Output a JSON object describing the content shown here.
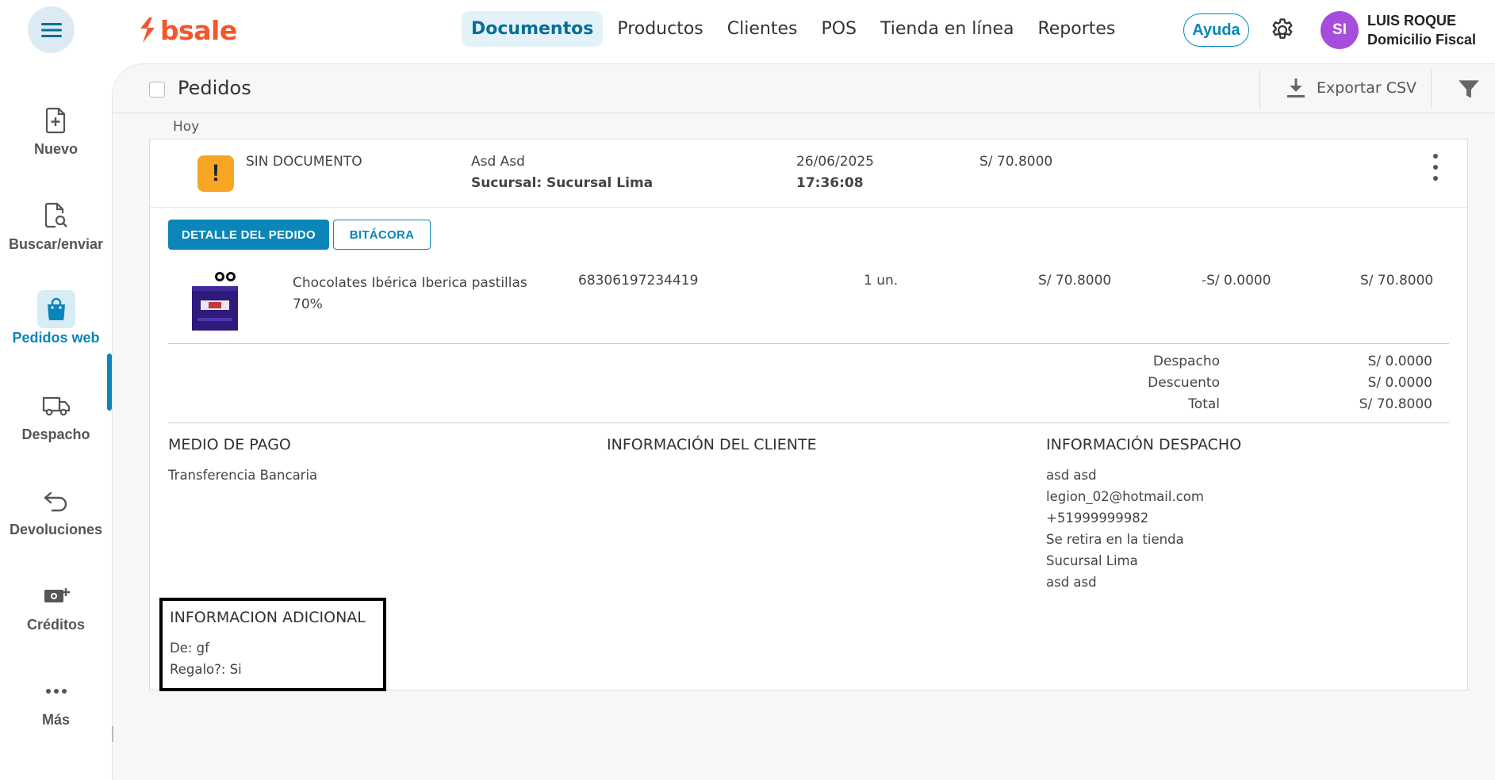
{
  "header": {
    "logo_text": "bsale",
    "brand_color": "#f2562b",
    "nav": [
      {
        "label": "Documentos",
        "active": true
      },
      {
        "label": "Productos",
        "active": false
      },
      {
        "label": "Clientes",
        "active": false
      },
      {
        "label": "POS",
        "active": false
      },
      {
        "label": "Tienda en línea",
        "active": false
      },
      {
        "label": "Reportes",
        "active": false
      }
    ],
    "help_label": "Ayuda",
    "avatar_initials": "SI",
    "user_name": "LUIS ROQUE",
    "user_subtitle": "Domicilio Fiscal"
  },
  "sidebar": {
    "items": [
      {
        "label": "Nuevo",
        "icon": "new-document-icon"
      },
      {
        "label": "Buscar/enviar",
        "icon": "search-document-icon"
      },
      {
        "label": "Pedidos web",
        "icon": "shopping-bag-icon",
        "active": true
      },
      {
        "label": "Despacho",
        "icon": "truck-icon"
      },
      {
        "label": "Devoluciones",
        "icon": "return-arrow-icon"
      },
      {
        "label": "Créditos",
        "icon": "cash-plus-icon"
      },
      {
        "label": "Más",
        "icon": "more-dots-icon"
      }
    ],
    "accent_color": "#0a86b8"
  },
  "panel": {
    "title": "Pedidos",
    "export_label": "Exportar CSV",
    "group_label": "Hoy"
  },
  "order": {
    "document": "SIN DOCUMENTO",
    "client": "Asd Asd",
    "branch": "Sucursal: Sucursal Lima",
    "date": "26/06/2025",
    "time": "17:36:08",
    "amount": "S/ 70.8000",
    "status_color": "#f6a623",
    "tabs": {
      "detail": "DETALLE DEL PEDIDO",
      "log": "BITÁCORA"
    },
    "items": [
      {
        "name": "Chocolates Ibérica Iberica pastillas 70%",
        "sku": "68306197234419",
        "qty": "1 un.",
        "price": "S/ 70.8000",
        "discount": "-S/ 0.0000",
        "total": "S/ 70.8000"
      }
    ],
    "summary": [
      {
        "label": "Despacho",
        "value": "S/ 0.0000"
      },
      {
        "label": "Descuento",
        "value": "S/ 0.0000"
      },
      {
        "label": "Total",
        "value": "S/ 70.8000"
      }
    ],
    "payment": {
      "title": "MEDIO DE PAGO",
      "lines": [
        "Transferencia Bancaria"
      ]
    },
    "client_info": {
      "title": "INFORMACIÓN DEL CLIENTE",
      "lines": []
    },
    "shipping": {
      "title": "INFORMACIÓN DESPACHO",
      "lines": [
        "asd asd",
        "legion_02@hotmail.com",
        "+51999999982",
        "Se retira en la tienda",
        "Sucursal Lima",
        "asd asd"
      ]
    },
    "additional": {
      "title": "INFORMACION ADICIONAL",
      "lines": [
        "De: gf",
        "Regalo?: Si"
      ]
    }
  }
}
